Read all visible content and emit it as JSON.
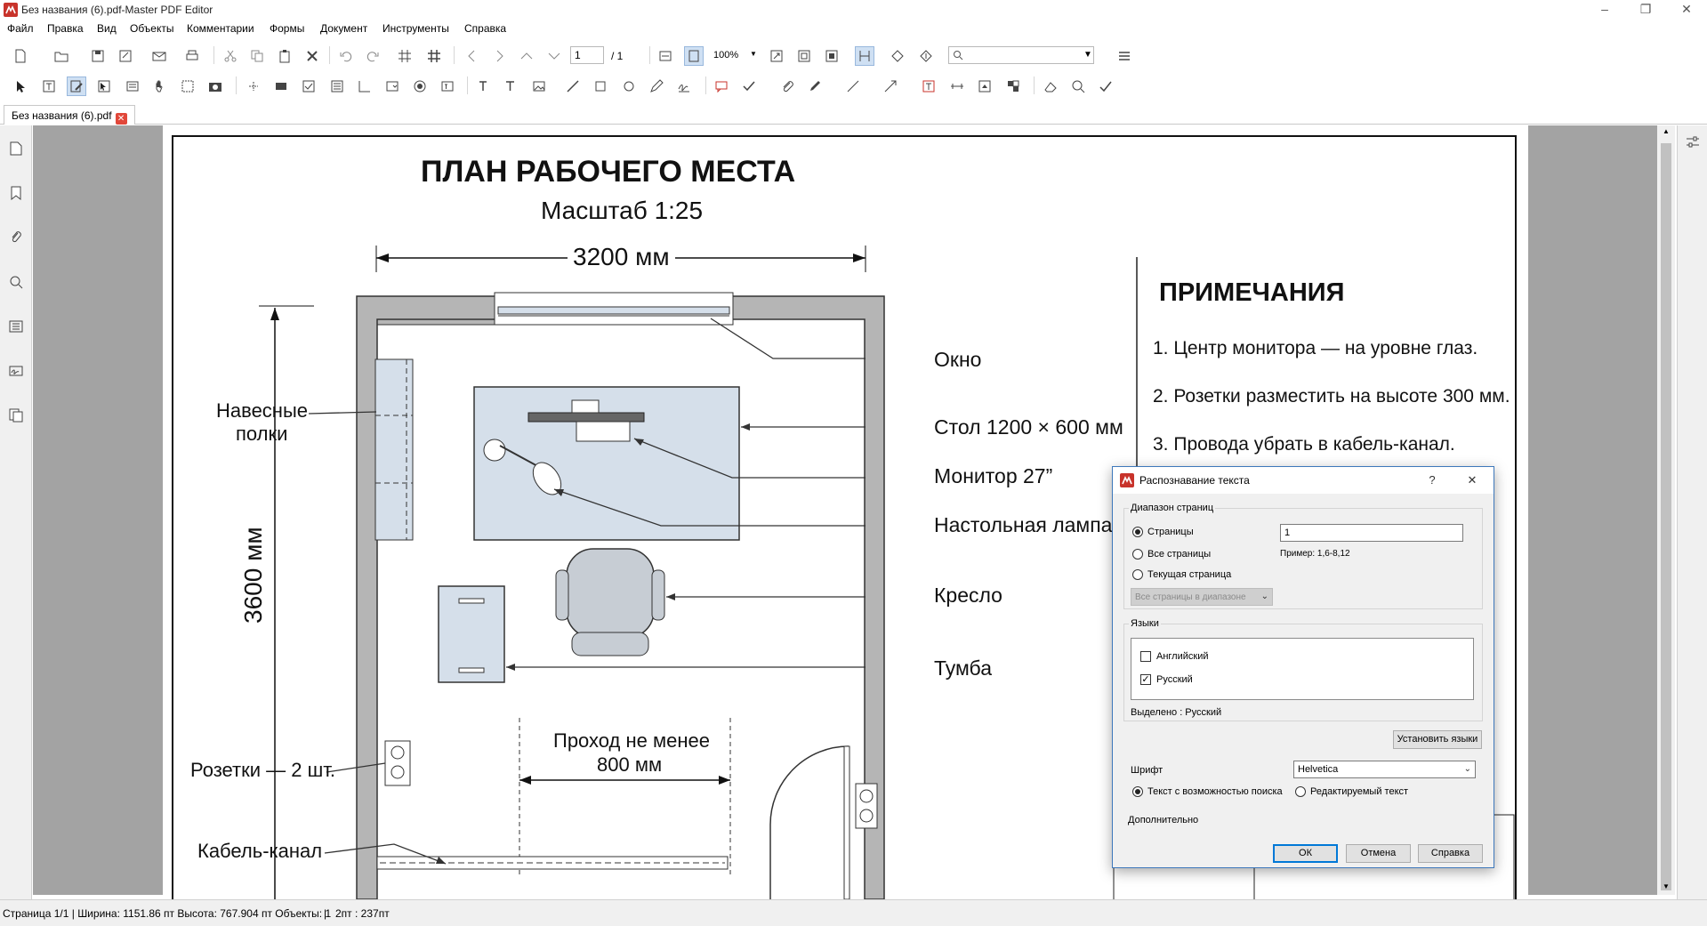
{
  "window": {
    "title": "Без названия (6).pdf-Master PDF Editor",
    "minimize": "–",
    "restore": "❐",
    "close": "✕"
  },
  "menu": [
    "Файл",
    "Правка",
    "Вид",
    "Объекты",
    "Комментарии",
    "Формы",
    "Документ",
    "Инструменты",
    "Справка"
  ],
  "toolbar": {
    "page_number": "1",
    "page_total": "/ 1",
    "zoom": "100%",
    "search_placeholder": ""
  },
  "tab": {
    "label": "Без названия (6).pdf",
    "close": "✕"
  },
  "drawing": {
    "title": "ПЛАН РАБОЧЕГО МЕСТА",
    "scale": "Масштаб 1:25",
    "width_dim": "3200 мм",
    "height_dim": "3600 мм",
    "labels": {
      "window": "Окно",
      "desk": "Стол 1200 × 600 мм",
      "monitor": "Монитор 27”",
      "lamp": "Настольная лампа",
      "chair": "Кресло",
      "cabinet": "Тумба",
      "shelves_1": "Навесные",
      "shelves_2": "полки",
      "sockets": "Розетки — 2 шт.",
      "cable": "Кабель-канал",
      "aisle_1": "Проход не менее",
      "aisle_2": "800 мм"
    },
    "notes_title": "ПРИМЕЧАНИЯ",
    "notes": [
      "1.  Центр монитора — на уровне глаз.",
      "2.  Розетки разместить на высоте 300 мм.",
      "3.  Провода убрать в кабель-канал."
    ]
  },
  "dialog": {
    "title": "Распознавание текста",
    "help": "?",
    "close": "✕",
    "page_range_group": "Диапазон страниц",
    "radio_pages": "Страницы",
    "pages_value": "1",
    "radio_all": "Все страницы",
    "example": "Пример: 1,6-8,12",
    "radio_current": "Текущая страница",
    "range_select": "Все страницы в диапазоне",
    "languages_group": "Языки",
    "lang_en": "Английский",
    "lang_ru": "Русский",
    "selected": "Выделено : Русский",
    "set_languages": "Установить языки",
    "font_label": "Шрифт",
    "font_value": "Helvetica",
    "radio_searchable": "Текст с возможностью поиска",
    "radio_editable": "Редактируемый текст",
    "advanced": "Дополнительно",
    "ok": "ОК",
    "cancel": "Отмена",
    "help_btn": "Справка"
  },
  "status": {
    "info": "Страница 1/1 | Ширина: 1151.86 пт Высота: 767.904 пт Объекты: 1",
    "sep": "|",
    "coords": "2пт : 237пт"
  },
  "colors": {
    "brand_red": "#c8332b",
    "dialog_border": "#3e78bb",
    "wall_gray": "#b5b5b5",
    "furniture_blue": "#d5dfea",
    "workspace": "#a3a3a3"
  }
}
